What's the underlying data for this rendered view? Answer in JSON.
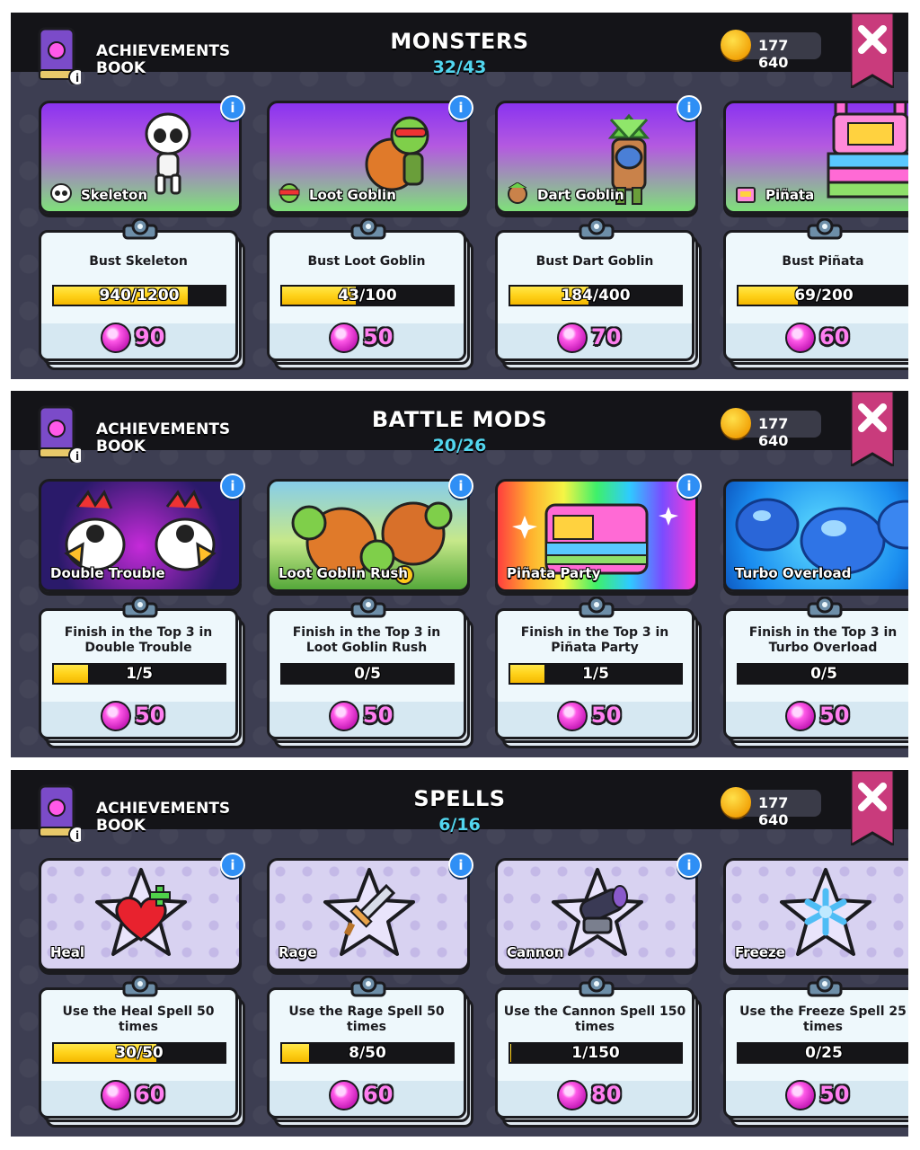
{
  "colors": {
    "panel_bg": "#3d3e52",
    "topbar_bg": "#141418",
    "count": "#52d6ef",
    "progress": "#ffd21a",
    "gem": "#ff59e8",
    "close_ribbon": "#c93b7c"
  },
  "panels": [
    {
      "book_label": [
        "ACHIEVEMENTS",
        "BOOK"
      ],
      "title": "MONSTERS",
      "count": "32/43",
      "coins": "177 640",
      "close_icon": "close-x-icon",
      "items": [
        {
          "name": "Skeleton",
          "icon": "skeleton-icon",
          "task": "Bust Skeleton",
          "progress": "940/1200",
          "fraction": 0.783,
          "reward": "90"
        },
        {
          "name": "Loot Goblin",
          "icon": "loot-goblin-icon",
          "task": "Bust Loot Goblin",
          "progress": "43/100",
          "fraction": 0.43,
          "reward": "50"
        },
        {
          "name": "Dart Goblin",
          "icon": "dart-goblin-icon",
          "task": "Bust Dart Goblin",
          "progress": "184/400",
          "fraction": 0.46,
          "reward": "70"
        },
        {
          "name": "Piñata",
          "icon": "pinata-icon",
          "task": "Bust Piñata",
          "progress": "69/200",
          "fraction": 0.345,
          "reward": "60"
        }
      ]
    },
    {
      "book_label": [
        "ACHIEVEMENTS",
        "BOOK"
      ],
      "title": "BATTLE MODS",
      "count": "20/26",
      "coins": "177 640",
      "close_icon": "close-x-icon",
      "items": [
        {
          "name": "Double Trouble",
          "icon": "double-trouble-art",
          "task": "Finish in the Top 3 in Double Trouble",
          "progress": "1/5",
          "fraction": 0.2,
          "reward": "50"
        },
        {
          "name": "Loot Goblin Rush",
          "icon": "loot-goblin-rush-art",
          "task": "Finish in the Top 3 in Loot Goblin Rush",
          "progress": "0/5",
          "fraction": 0,
          "reward": "50"
        },
        {
          "name": "Piñata Party",
          "icon": "pinata-party-art",
          "task": "Finish in the Top 3 in Piñata Party",
          "progress": "1/5",
          "fraction": 0.2,
          "reward": "50"
        },
        {
          "name": "Turbo Overload",
          "icon": "turbo-overload-art",
          "task": "Finish in the Top 3 in Turbo Overload",
          "progress": "0/5",
          "fraction": 0,
          "reward": "50"
        }
      ]
    },
    {
      "book_label": [
        "ACHIEVEMENTS",
        "BOOK"
      ],
      "title": "SPELLS",
      "count": "6/16",
      "coins": "177 640",
      "close_icon": "close-x-icon",
      "items": [
        {
          "name": "Heal",
          "icon": "heal-heart-icon",
          "task": "Use the Heal Spell 50 times",
          "progress": "30/50",
          "fraction": 0.6,
          "reward": "60"
        },
        {
          "name": "Rage",
          "icon": "rage-sword-icon",
          "task": "Use the Rage Spell 50 times",
          "progress": "8/50",
          "fraction": 0.16,
          "reward": "60"
        },
        {
          "name": "Cannon",
          "icon": "cannon-icon",
          "task": "Use the Cannon Spell 150 times",
          "progress": "1/150",
          "fraction": 0.007,
          "reward": "80"
        },
        {
          "name": "Freeze",
          "icon": "freeze-snowflake-icon",
          "task": "Use the Freeze Spell 25 times",
          "progress": "0/25",
          "fraction": 0,
          "reward": "50"
        }
      ]
    }
  ]
}
